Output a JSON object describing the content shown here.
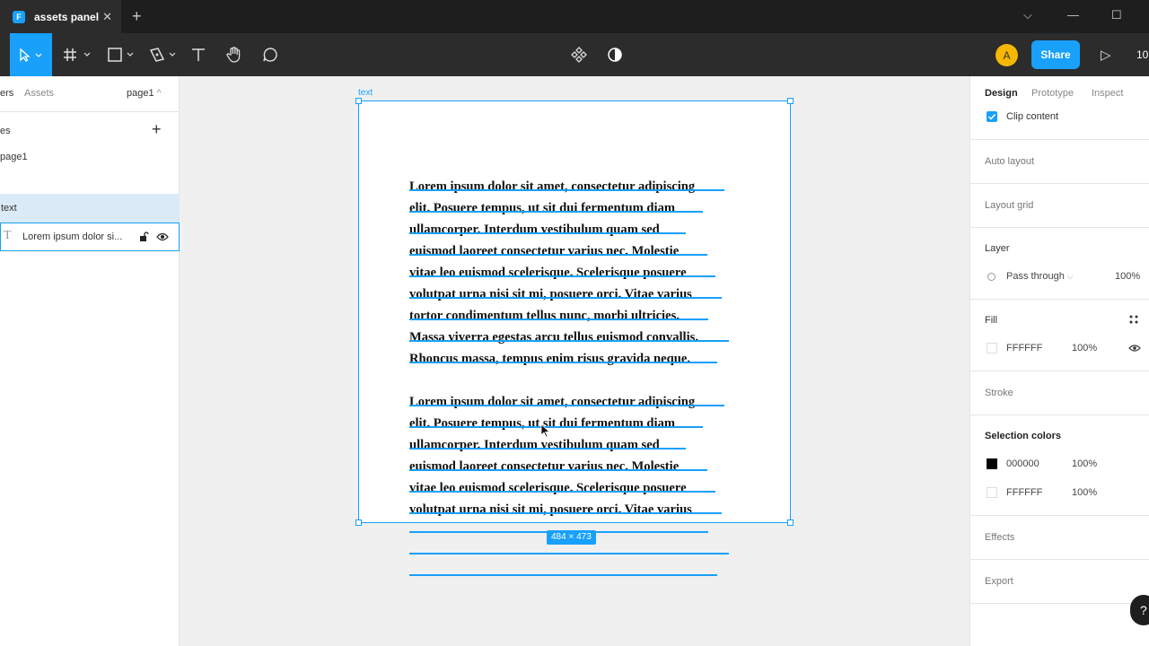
{
  "titlebar": {
    "tab_title": "assets panel",
    "logo_glyph": "F",
    "close_glyph": "✕",
    "new_tab_glyph": "+",
    "dropdown_glyph": "⌵",
    "minimize_glyph": "—",
    "maximize_glyph": "☐"
  },
  "toolbar": {
    "tools": [
      "move-icon",
      "frame-icon",
      "shape-icon",
      "pen-icon",
      "text-icon",
      "hand-icon",
      "comment-icon"
    ],
    "center_tools": [
      "component-icon",
      "contrast-icon"
    ],
    "avatar_initial": "A",
    "share_label": "Share",
    "play_glyph": "▷",
    "zoom_text": "10",
    "accent": "#18a0fb"
  },
  "left_panel": {
    "tab_layers": "ers",
    "tab_assets": "Assets",
    "page_selector": "page1",
    "pages_header": "es",
    "add_glyph": "+",
    "pages": [
      "page1"
    ],
    "layers": [
      {
        "name": "text",
        "type": "frame"
      },
      {
        "name": "Lorem ipsum dolor si...",
        "type": "text"
      }
    ]
  },
  "canvas": {
    "frame_label": "text",
    "dimensions": "484 × 473",
    "paragraph_1": [
      "Lorem ipsum dolor sit amet, consectetur adipiscing",
      "elit. Posuere tempus, ut sit dui fermentum diam",
      "ullamcorper. Interdum vestibulum quam sed",
      "euismod laoreet consectetur varius nec. Molestie",
      "vitae leo euismod scelerisque. Scelerisque posuere",
      "volutpat urna nisi sit mi, posuere orci. Vitae varius",
      "tortor condimentum tellus nunc, morbi ultricies.",
      "Massa viverra egestas arcu tellus euismod convallis.",
      "Rhoncus massa, tempus enim risus gravida neque."
    ],
    "paragraph_2": [
      "Lorem ipsum dolor sit amet, consectetur adipiscing",
      "elit. Posuere tempus, ut sit dui fermentum diam",
      "ullamcorper. Interdum vestibulum quam sed",
      "euismod laoreet consectetur varius nec. Molestie",
      "vitae leo euismod scelerisque. Scelerisque posuere",
      "volutpat urna nisi sit mi, posuere orci. Vitae varius"
    ]
  },
  "right_panel": {
    "tabs": [
      "Design",
      "Prototype",
      "Inspect"
    ],
    "clip_content_label": "Clip content",
    "auto_layout": "Auto layout",
    "layout_grid": "Layout grid",
    "layer_title": "Layer",
    "blend_mode": "Pass through",
    "layer_opacity": "100%",
    "fill_title": "Fill",
    "fill_hex": "FFFFFF",
    "fill_opacity": "100%",
    "stroke_title": "Stroke",
    "selection_colors_title": "Selection colors",
    "selection_colors": [
      {
        "hex": "000000",
        "opacity": "100%",
        "color": "#000000"
      },
      {
        "hex": "FFFFFF",
        "opacity": "100%",
        "color": "#ffffff"
      }
    ],
    "effects_title": "Effects",
    "export_title": "Export",
    "help_glyph": "?"
  }
}
